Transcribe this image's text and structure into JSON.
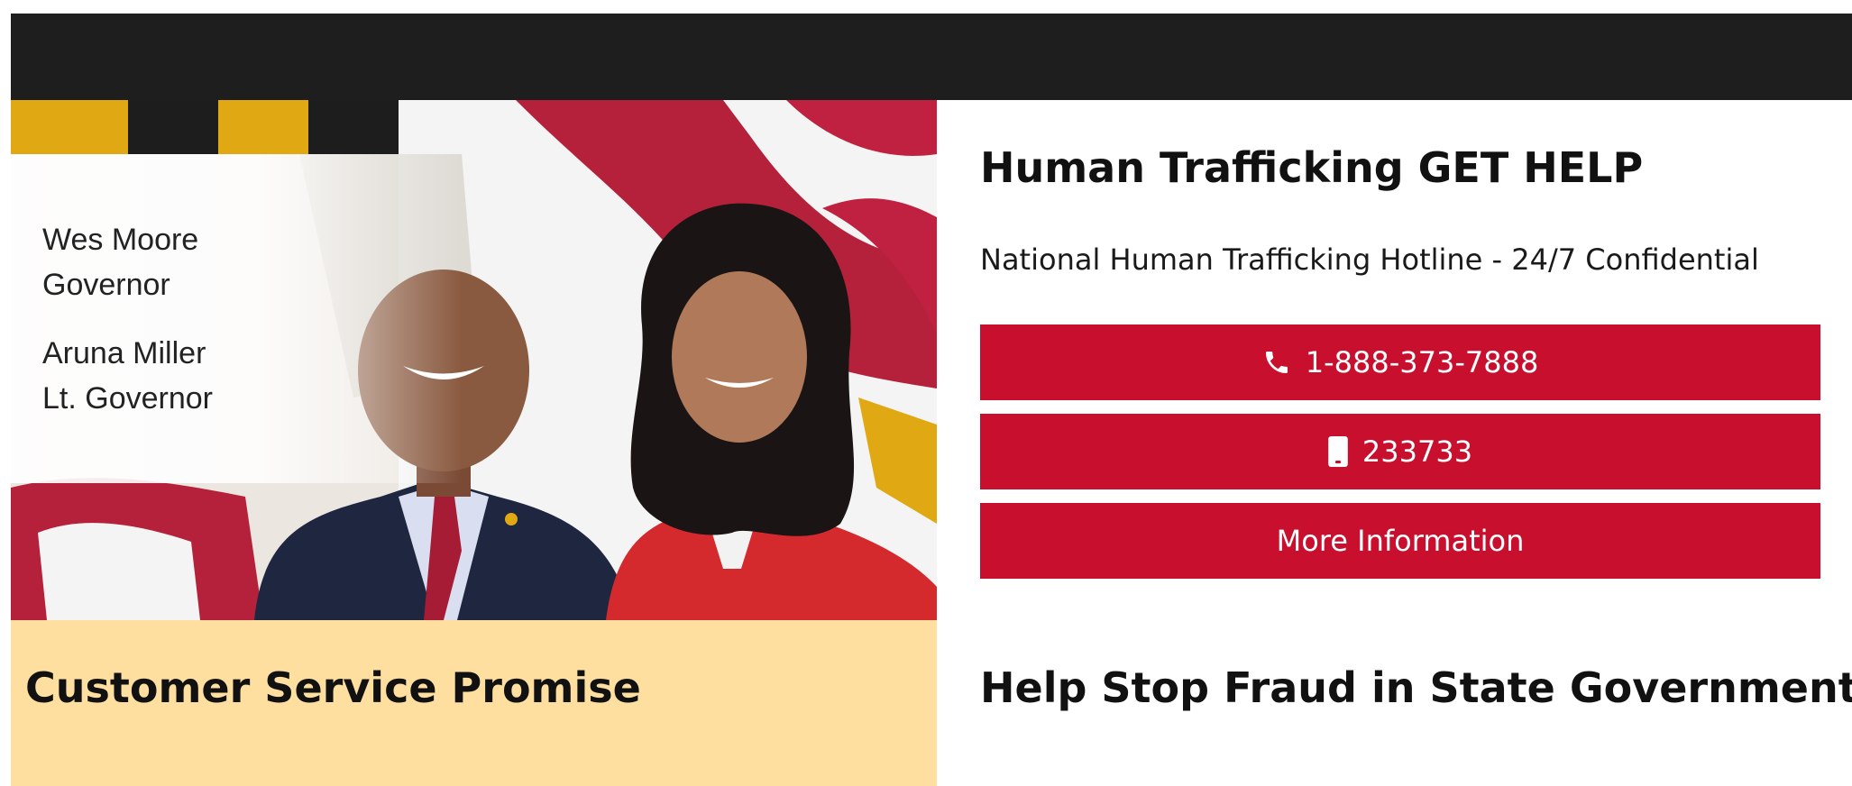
{
  "hero": {
    "governor_name": "Wes Moore",
    "governor_title": "Governor",
    "lt_governor_name": "Aruna Miller",
    "lt_governor_title": "Lt. Governor"
  },
  "promise": {
    "title": "Customer Service Promise"
  },
  "trafficking": {
    "title": "Human Trafficking GET HELP",
    "hotline_description": "National Human Trafficking Hotline - 24/7 Confidential",
    "phone_label": "1-888-373-7888",
    "phone_icon": "phone-icon",
    "text_label": "233733",
    "text_icon": "mobile-phone-icon",
    "more_label": "More Information"
  },
  "fraud": {
    "title": "Help Stop Fraud in State Government"
  },
  "colors": {
    "top_bar": "#1e1e1e",
    "accent_red": "#c8102e",
    "promise_bg": "#ffdfa0"
  }
}
